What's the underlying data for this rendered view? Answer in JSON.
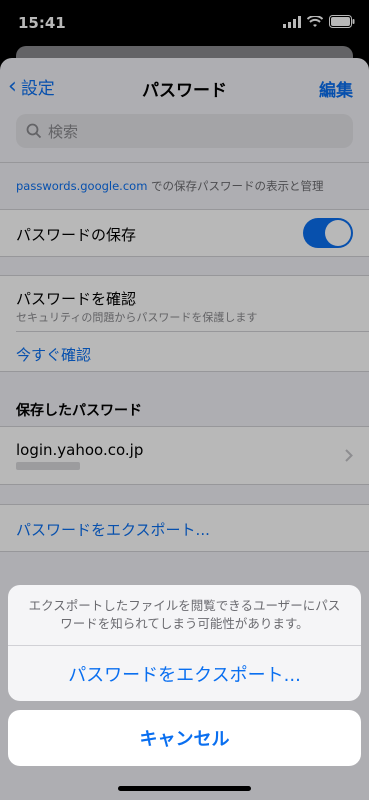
{
  "status_bar": {
    "time": "15:41"
  },
  "nav": {
    "back_label": "設定",
    "title": "パスワード",
    "edit_label": "編集"
  },
  "search": {
    "placeholder": "検索"
  },
  "info": {
    "link": "passwords.google.com",
    "text": " での保存パスワードの表示と管理"
  },
  "save_passwords": {
    "label": "パスワードの保存",
    "enabled": true
  },
  "check": {
    "title": "パスワードを確認",
    "subtitle": "セキュリティの問題からパスワードを保護します",
    "action": "今すぐ確認"
  },
  "saved_section": {
    "header": "保存したパスワード",
    "items": [
      {
        "site": "login.yahoo.co.jp"
      }
    ]
  },
  "export_link": "パスワードをエクスポート...",
  "action_sheet": {
    "message": "エクスポートしたファイルを閲覧できるユーザーにパスワードを知られてしまう可能性があります。",
    "export_button": "パスワードをエクスポート...",
    "cancel_button": "キャンセル"
  },
  "colors": {
    "accent": "#0a6ff0"
  }
}
